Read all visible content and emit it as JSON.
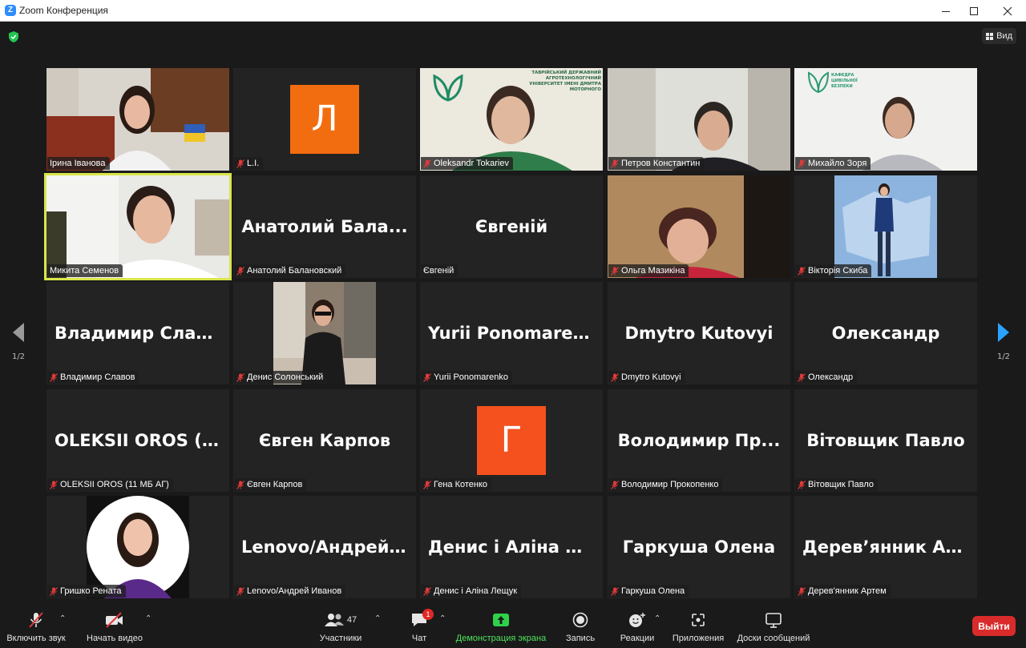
{
  "window": {
    "title": "Zoom Конференция"
  },
  "header": {
    "view_label": "Вид"
  },
  "pager": {
    "left": "1/2",
    "right": "1/2"
  },
  "tiles": [
    {
      "name": "Ірина Іванова",
      "display": ""
    },
    {
      "name": "L.I.",
      "display": "",
      "avatar_letter": "Л"
    },
    {
      "name": "Oleksandr Tokariev",
      "display": ""
    },
    {
      "name": "Петров Константин",
      "display": ""
    },
    {
      "name": "Михайло Зоря",
      "display": ""
    },
    {
      "name": "Микита Семенов",
      "display": ""
    },
    {
      "name": "Анатолий Балановский",
      "display": "Анатолий  Бала..."
    },
    {
      "name": "Євгеній",
      "display": "Євгеній"
    },
    {
      "name": "Ольга Мазикіна",
      "display": ""
    },
    {
      "name": "Вікторія Скиба",
      "display": ""
    },
    {
      "name": "Владимир Славов",
      "display": "Владимир  Слав..."
    },
    {
      "name": "Денис Солонський",
      "display": ""
    },
    {
      "name": "Yurii Ponomarenko",
      "display": "Yurii  Ponomaren..."
    },
    {
      "name": "Dmytro Kutovyi",
      "display": "Dmytro Kutovyi"
    },
    {
      "name": "Олександр",
      "display": "Олександр"
    },
    {
      "name": "OLEKSII OROS (11 МБ АГ)",
      "display": "OLEKSII  OROS  (1..."
    },
    {
      "name": "Євген Карпов",
      "display": "Євген Карпов"
    },
    {
      "name": "Гена Котенко",
      "display": "",
      "avatar_letter": "Г"
    },
    {
      "name": "Володимир Прокопенко",
      "display": "Володимир  Пр..."
    },
    {
      "name": "Вітовщик Павло",
      "display": "Вітовщик Павло"
    },
    {
      "name": "Гришко Рената",
      "display": ""
    },
    {
      "name": "Lenovo/Андрей Иванов",
      "display": "Lenovo/Андрей..."
    },
    {
      "name": "Денис і Аліна Лещук",
      "display": "Денис і Аліна Л..."
    },
    {
      "name": "Гаркуша Олена",
      "display": "Гаркуша Олена"
    },
    {
      "name": "Дерев'янник Артем",
      "display": "Дерев’янник  Ар..."
    }
  ],
  "logos": {
    "university": "ТАВРІЙСЬКИЙ ДЕРЖАВНИЙ АГРОТЕХНОЛОГІЧНИЙ УНІВЕРСИТЕТ ІМЕНІ ДМИТРА МОТОРНОГО",
    "department": "КАФЕДРА ЦИВІЛЬНОЇ БЕЗПЕКИ"
  },
  "toolbar": {
    "audio": "Включить звук",
    "video": "Начать видео",
    "participants": "Участники",
    "participants_count": "47",
    "chat": "Чат",
    "chat_badge": "1",
    "share": "Демонстрация экрана",
    "record": "Запись",
    "reactions": "Реакции",
    "apps": "Приложения",
    "whiteboards": "Доски сообщений",
    "end": "Выйти"
  },
  "colors": {
    "accent": "#2d8cff",
    "active_speaker": "#d9e54a",
    "share_green": "#4ee35c",
    "end_red": "#d92b2b",
    "avatar_l": "#f26d0f",
    "avatar_g": "#f4511e"
  }
}
